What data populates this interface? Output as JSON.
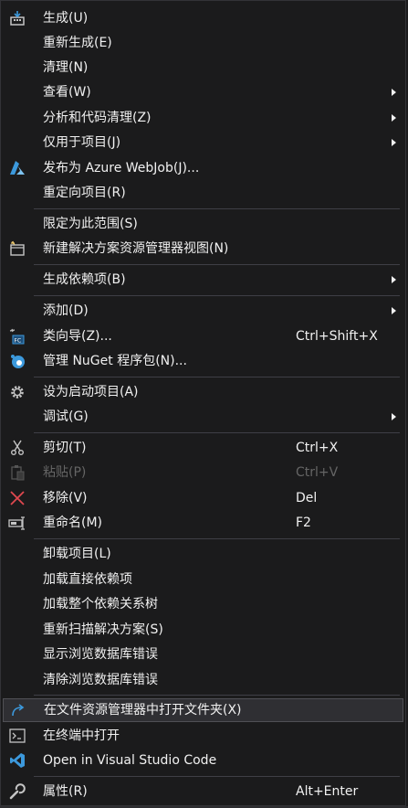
{
  "menu": {
    "build": {
      "label": "生成(U)",
      "icon": "build-icon"
    },
    "rebuild": {
      "label": "重新生成(E)"
    },
    "clean": {
      "label": "清理(N)"
    },
    "view": {
      "label": "查看(W)"
    },
    "analyze": {
      "label": "分析和代码清理(Z)"
    },
    "project_only": {
      "label": "仅用于项目(J)"
    },
    "publish": {
      "label": "发布为 Azure WebJob(J)...",
      "icon": "azure-icon"
    },
    "retarget": {
      "label": "重定向项目(R)"
    },
    "scope": {
      "label": "限定为此范围(S)"
    },
    "new_view": {
      "label": "新建解决方案资源管理器视图(N)",
      "icon": "new-view-icon"
    },
    "build_deps": {
      "label": "生成依赖项(B)"
    },
    "add": {
      "label": "添加(D)"
    },
    "class_wizard": {
      "label": "类向导(Z)...",
      "shortcut": "Ctrl+Shift+X",
      "icon": "class-wizard-icon"
    },
    "nuget": {
      "label": "管理 NuGet 程序包(N)...",
      "icon": "nuget-icon"
    },
    "startup": {
      "label": "设为启动项目(A)",
      "icon": "gear-icon"
    },
    "debug": {
      "label": "调试(G)"
    },
    "cut": {
      "label": "剪切(T)",
      "shortcut": "Ctrl+X",
      "icon": "scissors-icon"
    },
    "paste": {
      "label": "粘贴(P)",
      "shortcut": "Ctrl+V",
      "icon": "clipboard-icon"
    },
    "remove": {
      "label": "移除(V)",
      "shortcut": "Del",
      "icon": "remove-icon"
    },
    "rename": {
      "label": "重命名(M)",
      "shortcut": "F2",
      "icon": "rename-icon"
    },
    "unload": {
      "label": "卸载项目(L)"
    },
    "load_direct": {
      "label": "加载直接依赖项"
    },
    "load_tree": {
      "label": "加载整个依赖关系树"
    },
    "rescan": {
      "label": "重新扫描解决方案(S)"
    },
    "show_db_errors": {
      "label": "显示浏览数据库错误"
    },
    "clear_db_errors": {
      "label": "清除浏览数据库错误"
    },
    "open_folder": {
      "label": "在文件资源管理器中打开文件夹(X)",
      "icon": "open-folder-arrow-icon"
    },
    "open_terminal": {
      "label": "在终端中打开",
      "icon": "terminal-icon"
    },
    "open_vscode": {
      "label": "Open in Visual Studio Code",
      "icon": "vscode-icon"
    },
    "properties": {
      "label": "属性(R)",
      "shortcut": "Alt+Enter",
      "icon": "wrench-icon"
    }
  },
  "colors": {
    "background": "#1b1b1c",
    "text": "#f1f1f1",
    "disabled_text": "#656565",
    "separator": "#3f3f46",
    "highlight": "#2f2f33",
    "accent_blue": "#3c99dc"
  }
}
